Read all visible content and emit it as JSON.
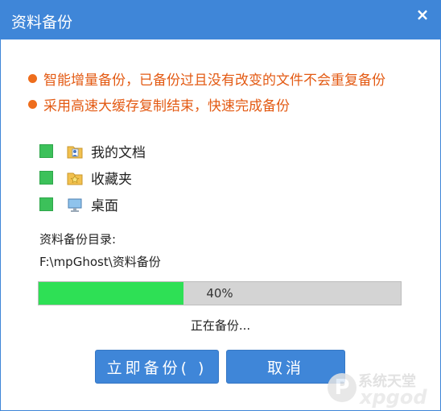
{
  "window": {
    "title": "资料备份",
    "close_glyph": "×"
  },
  "notes": [
    "智能增量备份，已备份过且没有改变的文件不会重复备份",
    "采用高速大缓存复制结束，快速完成备份"
  ],
  "items": [
    {
      "label": "我的文档",
      "icon": "documents-folder-icon",
      "checked": true
    },
    {
      "label": "收藏夹",
      "icon": "favorites-folder-icon",
      "checked": true
    },
    {
      "label": "桌面",
      "icon": "desktop-icon",
      "checked": true
    }
  ],
  "backup_dir": {
    "label": "资料备份目录:",
    "path": "F:\\mpGhost\\资料备份"
  },
  "progress": {
    "fraction": 0.4,
    "text": "40%"
  },
  "status": "正在备份...",
  "buttons": {
    "backup": "立即备份( )",
    "cancel": "取消"
  },
  "watermark": {
    "line1": "系统天堂",
    "line2": "xpgod",
    "mark": "P"
  },
  "colors": {
    "accent": "#3f86d8",
    "progress_fill": "#2ee055",
    "note_text": "#e35a13",
    "checkbox": "#3cc15a"
  }
}
